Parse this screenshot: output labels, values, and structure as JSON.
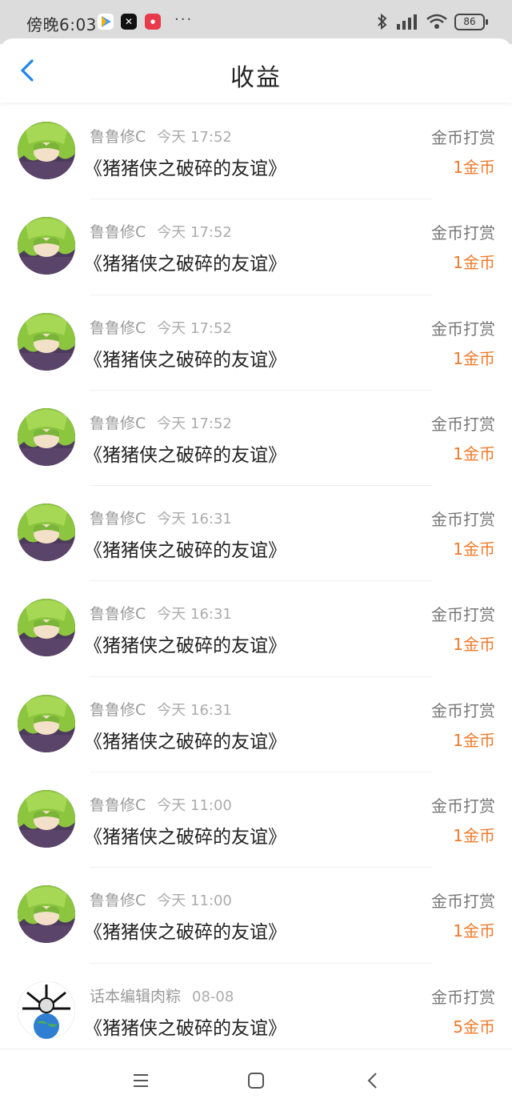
{
  "status_bar": {
    "time": "傍晚6:03",
    "dots": "···",
    "battery": "86"
  },
  "header": {
    "title": "收益"
  },
  "items": [
    {
      "user": "鲁鲁修C",
      "time": "今天 17:52",
      "title": "《猪猪侠之破碎的友谊》",
      "reward_type": "金币打赏",
      "amount": "1金币",
      "avatar": "green-hair"
    },
    {
      "user": "鲁鲁修C",
      "time": "今天 17:52",
      "title": "《猪猪侠之破碎的友谊》",
      "reward_type": "金币打赏",
      "amount": "1金币",
      "avatar": "green-hair"
    },
    {
      "user": "鲁鲁修C",
      "time": "今天 17:52",
      "title": "《猪猪侠之破碎的友谊》",
      "reward_type": "金币打赏",
      "amount": "1金币",
      "avatar": "green-hair"
    },
    {
      "user": "鲁鲁修C",
      "time": "今天 17:52",
      "title": "《猪猪侠之破碎的友谊》",
      "reward_type": "金币打赏",
      "amount": "1金币",
      "avatar": "green-hair"
    },
    {
      "user": "鲁鲁修C",
      "time": "今天 16:31",
      "title": "《猪猪侠之破碎的友谊》",
      "reward_type": "金币打赏",
      "amount": "1金币",
      "avatar": "green-hair"
    },
    {
      "user": "鲁鲁修C",
      "time": "今天 16:31",
      "title": "《猪猪侠之破碎的友谊》",
      "reward_type": "金币打赏",
      "amount": "1金币",
      "avatar": "green-hair"
    },
    {
      "user": "鲁鲁修C",
      "time": "今天 16:31",
      "title": "《猪猪侠之破碎的友谊》",
      "reward_type": "金币打赏",
      "amount": "1金币",
      "avatar": "green-hair"
    },
    {
      "user": "鲁鲁修C",
      "time": "今天 11:00",
      "title": "《猪猪侠之破碎的友谊》",
      "reward_type": "金币打赏",
      "amount": "1金币",
      "avatar": "green-hair"
    },
    {
      "user": "鲁鲁修C",
      "time": "今天 11:00",
      "title": "《猪猪侠之破碎的友谊》",
      "reward_type": "金币打赏",
      "amount": "1金币",
      "avatar": "green-hair"
    },
    {
      "user": "话本编辑肉粽",
      "time": "08-08",
      "title": "《猪猪侠之破碎的友谊》",
      "reward_type": "金币打赏",
      "amount": "5金币",
      "avatar": "earth-logo"
    }
  ],
  "colors": {
    "accent_blue": "#1e88e5",
    "reward_orange": "#f07a2a"
  },
  "icons": {
    "back": "chevron-left-icon",
    "nav_menu": "menu-icon",
    "nav_home": "square-icon",
    "nav_back": "back-icon"
  }
}
